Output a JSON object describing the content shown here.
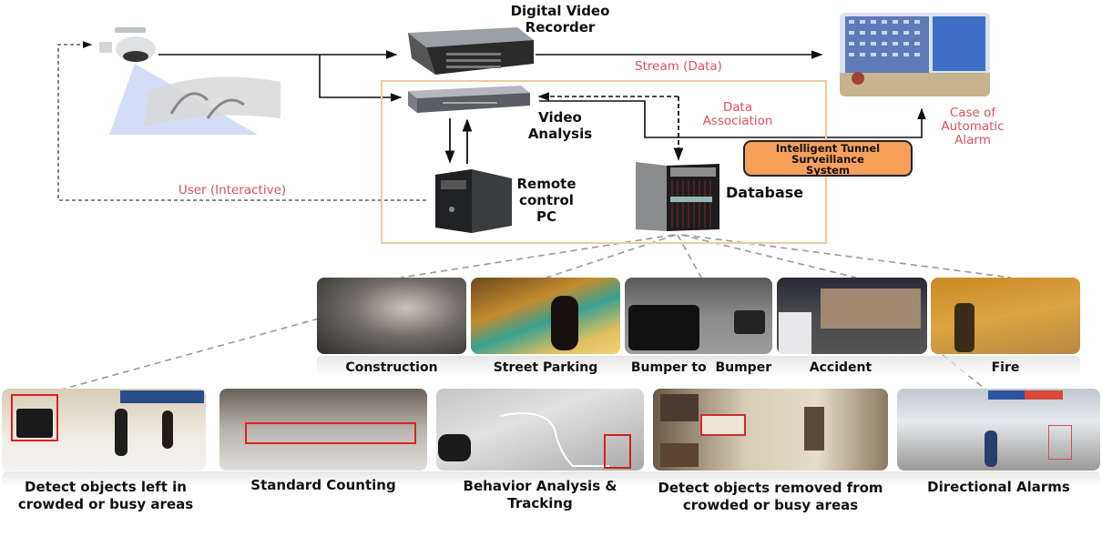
{
  "diagram": {
    "title": "Intelligent Tunnel Surveillance System",
    "components": {
      "dvr": "Digital Video Recorder",
      "video_analysis": "Video Analysis",
      "remote_pc": "Remote control PC",
      "database": "Database",
      "system_box": "Intelligent Tunnel Surveillance System"
    },
    "components_lines": {
      "dvr": [
        "Digital Video",
        "Recorder"
      ],
      "video_analysis": [
        "Video",
        "Analysis"
      ],
      "remote_pc": [
        "Remote",
        "control",
        "PC"
      ],
      "system_box": [
        "Intelligent Tunnel",
        "Surveillance",
        "System"
      ]
    },
    "flows": {
      "stream": "Stream (Data)",
      "data_association": [
        "Data",
        "Association"
      ],
      "automatic_alarm": [
        "Case of",
        "Automatic",
        "Alarm"
      ],
      "user_interactive": "User (Interactive)"
    },
    "icons": {
      "camera": "cctv-camera-icon",
      "tunnel": "tunnel-illustration",
      "dvr": "dvr-device-icon",
      "server": "rack-server-icon",
      "pc": "tower-pc-icon",
      "database": "server-cabinet-icon",
      "control_room": "control-room-image"
    },
    "colors": {
      "flow_label": "#e0505a",
      "system_border": "#f2c9a0",
      "system_fill": "#f7a05a",
      "line": "#111111",
      "dashed_link": "#9a9a9a"
    },
    "scenarios": [
      {
        "label": "Construction"
      },
      {
        "label": "Street Parking"
      },
      {
        "label": "Bumper to  Bumper"
      },
      {
        "label": "Accident"
      },
      {
        "label": "Fire"
      }
    ],
    "functions": [
      {
        "label_lines": [
          "Detect objects left in",
          "crowded or busy areas"
        ]
      },
      {
        "label_lines": [
          "Standard Counting"
        ]
      },
      {
        "label_lines": [
          "Behavior Analysis &",
          "Tracking"
        ]
      },
      {
        "label_lines": [
          "Detect objects removed from",
          "crowded or busy areas"
        ]
      },
      {
        "label_lines": [
          "Directional Alarms"
        ]
      }
    ]
  }
}
